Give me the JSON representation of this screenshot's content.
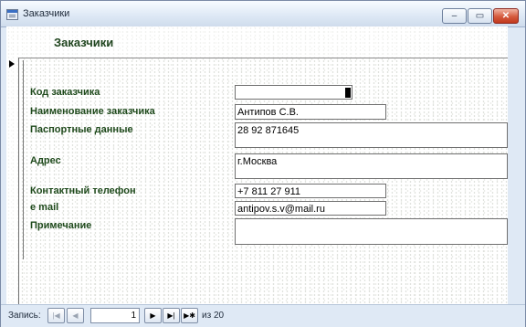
{
  "window": {
    "title": "Заказчики",
    "minimize": "–",
    "maximize": "▭",
    "close": "✕"
  },
  "form": {
    "title": "Заказчики",
    "fields": [
      {
        "label": "Код заказчика",
        "value": ""
      },
      {
        "label": "Наименование заказчика",
        "value": "Антипов С.В."
      },
      {
        "label": "Паспортные данные",
        "value": "28 92 871645"
      },
      {
        "label": "Адрес",
        "value": "г.Москва"
      },
      {
        "label": "Контактный телефон",
        "value": "+7 811 27 911"
      },
      {
        "label": "e mail",
        "value": "antipov.s.v@mail.ru"
      },
      {
        "label": "Примечание",
        "value": ""
      }
    ]
  },
  "navigation": {
    "record_label": "Запись:",
    "first": "|◀",
    "prev": "◀",
    "current": "1",
    "next": "▶",
    "last": "▶|",
    "new": "▶✱",
    "of_label": "из",
    "total": "20"
  }
}
